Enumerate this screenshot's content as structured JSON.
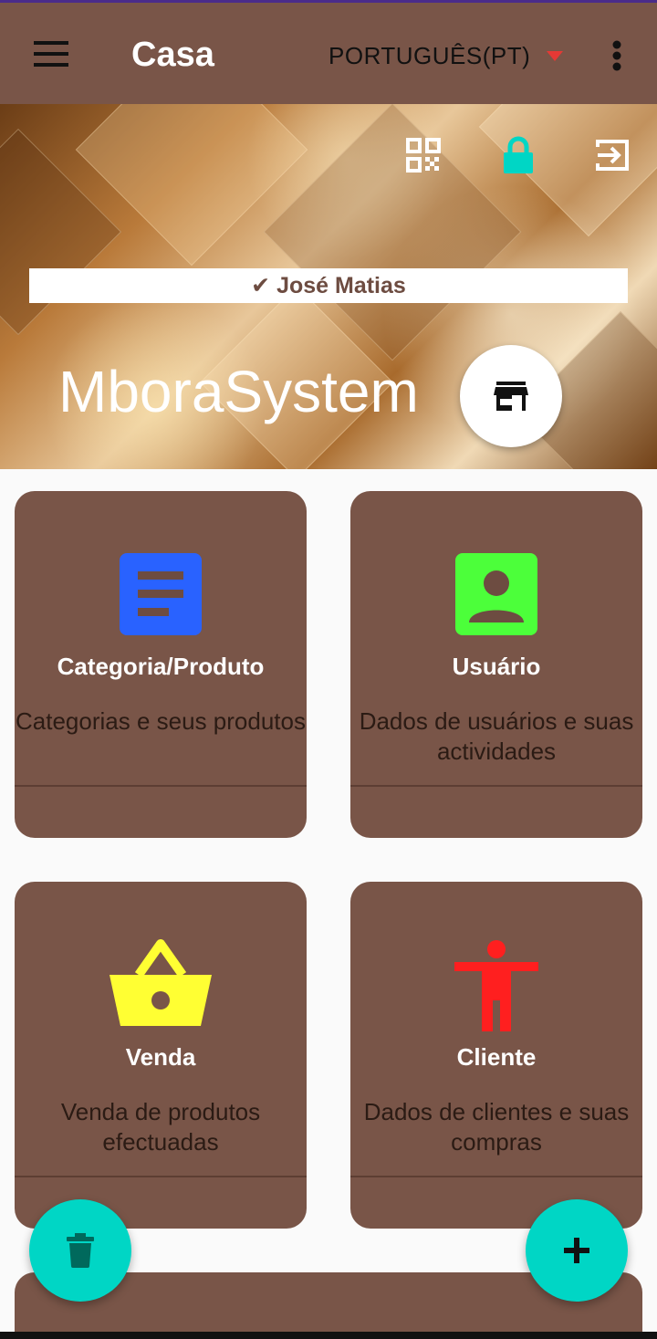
{
  "appbar": {
    "title": "Casa",
    "language": "PORTUGUÊS(PT)",
    "icons": [
      "menu-icon",
      "dropdown-arrow-icon",
      "more-vert-icon"
    ],
    "background": "#795548"
  },
  "hero": {
    "user_name": "✔ José Matias",
    "brand": "MboraSystem",
    "icons": [
      "qr-code-icon",
      "lock-icon",
      "logout-icon",
      "store-icon"
    ],
    "lock_color": "#00d6c5"
  },
  "cards": [
    {
      "title": "Categoria/Produto",
      "description": "Categorias e seus produtos",
      "icon": "category-document-icon",
      "icon_color": "#2962ff"
    },
    {
      "title": "Usuário",
      "description": "Dados de usuários e suas actividades",
      "icon": "user-account-icon",
      "icon_color": "#4cff3a"
    },
    {
      "title": "Venda",
      "description": "Venda de produtos efectuadas",
      "icon": "shopping-basket-icon",
      "icon_color": "#ffff33"
    },
    {
      "title": "Cliente",
      "description": "Dados de clientes e suas compras",
      "icon": "person-icon",
      "icon_color": "#ff1f1f"
    }
  ],
  "fabs": {
    "left_icon": "trash-icon",
    "right_icon": "add-icon",
    "color": "#00d6c5"
  }
}
